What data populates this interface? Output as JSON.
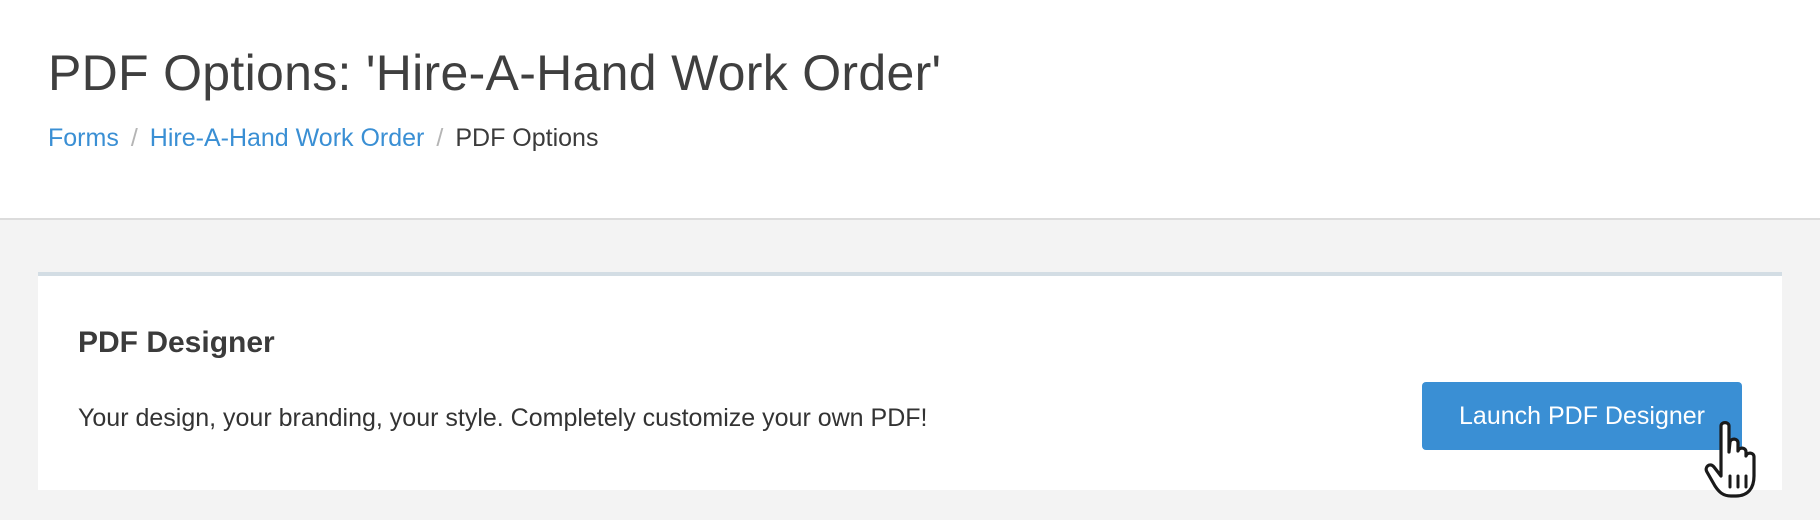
{
  "header": {
    "title": "PDF Options: 'Hire-A-Hand Work Order'",
    "breadcrumb": {
      "items": [
        {
          "label": "Forms"
        },
        {
          "label": "Hire-A-Hand Work Order"
        },
        {
          "label": "PDF Options"
        }
      ],
      "separator": "/"
    }
  },
  "panel": {
    "title": "PDF Designer",
    "description": "Your design, your branding, your style. Completely customize your own PDF!",
    "button_label": "Launch PDF Designer"
  },
  "cursor": {
    "icon": "hand-pointer-icon"
  },
  "colors": {
    "accent": "#3a8fd4",
    "background": "#f3f3f3",
    "panel_top_border": "#d3dde4"
  }
}
